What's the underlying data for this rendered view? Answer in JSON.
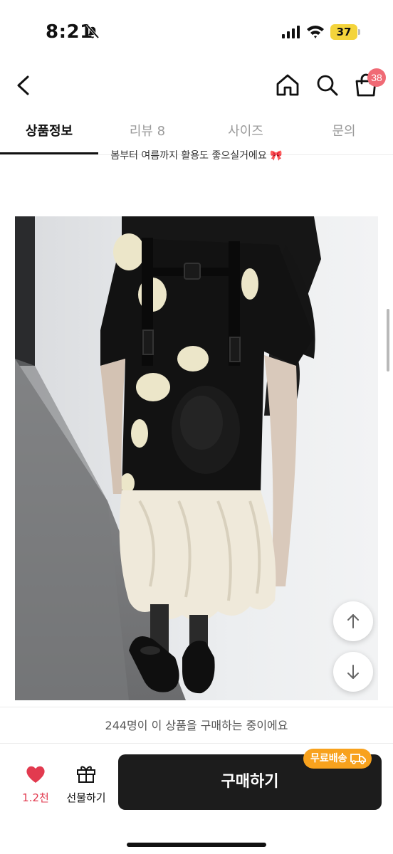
{
  "status_bar": {
    "time": "8:21",
    "battery": "37"
  },
  "navbar": {
    "cart_count": "38"
  },
  "tabs": [
    {
      "label": "상품정보"
    },
    {
      "label": "리뷰 8"
    },
    {
      "label": "사이즈"
    },
    {
      "label": "문의"
    }
  ],
  "caption": "봄부터 여름까지 활용도 좋으실거에요 🎀",
  "buyers_notice": "244명이 이 상품을 구매하는 중이에요",
  "bottom_bar": {
    "like_count": "1.2천",
    "gift_label": "선물하기",
    "buy_label": "구매하기",
    "free_shipping_badge": "무료배송"
  },
  "colors": {
    "accent_badge": "#f06a75",
    "like": "#e23a4f",
    "free_shipping": "#f8a21d",
    "buy_button": "#1c1c1c"
  }
}
